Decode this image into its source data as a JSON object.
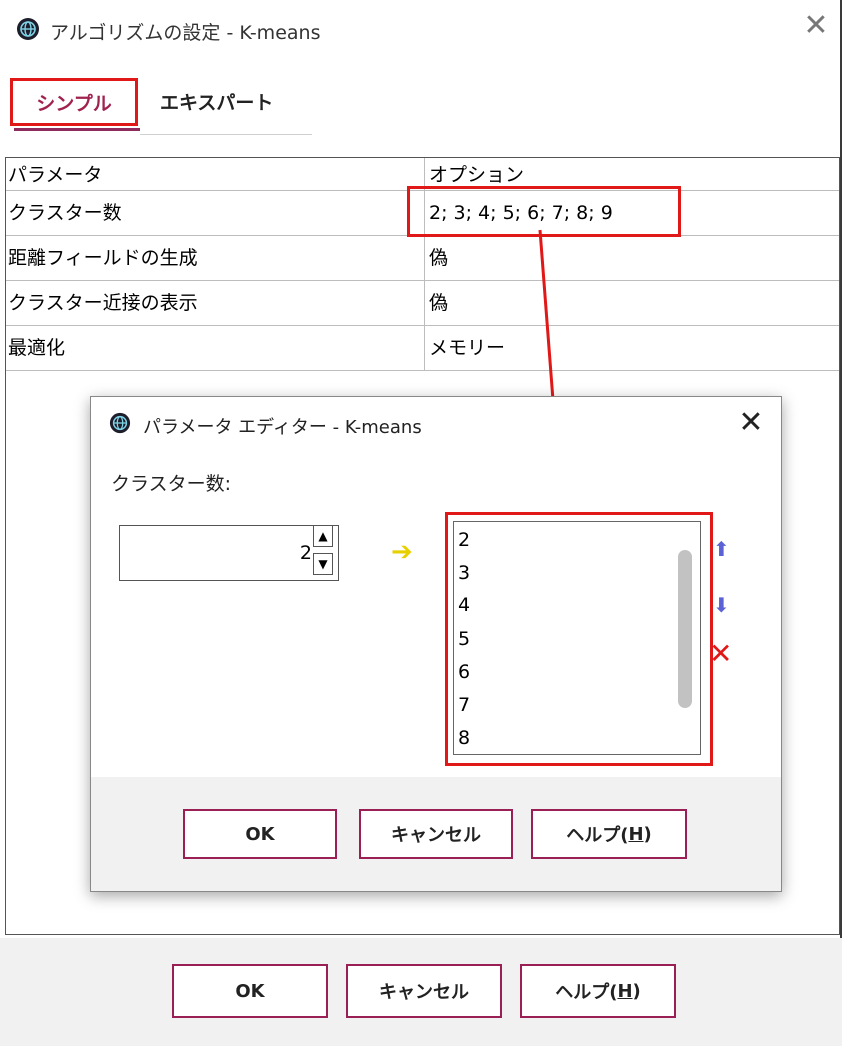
{
  "main_window": {
    "title": "アルゴリズムの設定 - K-means",
    "close_glyph": "✕",
    "tabs": [
      {
        "label": "シンプル",
        "active": true
      },
      {
        "label": "エキスパート",
        "active": false
      }
    ],
    "table": {
      "headers": [
        "パラメータ",
        "オプション"
      ],
      "rows": [
        [
          "クラスター数",
          "2; 3; 4; 5; 6; 7; 8; 9"
        ],
        [
          "距離フィールドの生成",
          "偽"
        ],
        [
          "クラスター近接の表示",
          "偽"
        ],
        [
          "最適化",
          "メモリー"
        ]
      ]
    },
    "buttons": {
      "ok": "OK",
      "cancel": "キャンセル",
      "help_prefix": "ヘルプ(",
      "help_key": "H",
      "help_suffix": ")"
    }
  },
  "dialog": {
    "title": "パラメータ エディター - K-means",
    "close_glyph": "✕",
    "field_label": "クラスター数:",
    "spinner_value": "2",
    "list_items": [
      "2",
      "3",
      "4",
      "5",
      "6",
      "7",
      "8"
    ],
    "buttons": {
      "ok": "OK",
      "cancel": "キャンセル",
      "help_prefix": "ヘルプ(",
      "help_key": "H",
      "help_suffix": ")"
    }
  },
  "colors": {
    "accent": "#9a1f55",
    "highlight": "#e01818",
    "move_arrows": "#5a62d6",
    "add_arrow": "#e8d000"
  },
  "icons": {
    "app": "globe-icon",
    "close": "close-icon",
    "add": "arrow-right-icon",
    "up": "arrow-up-icon",
    "down": "arrow-down-icon",
    "delete": "delete-x-icon"
  }
}
